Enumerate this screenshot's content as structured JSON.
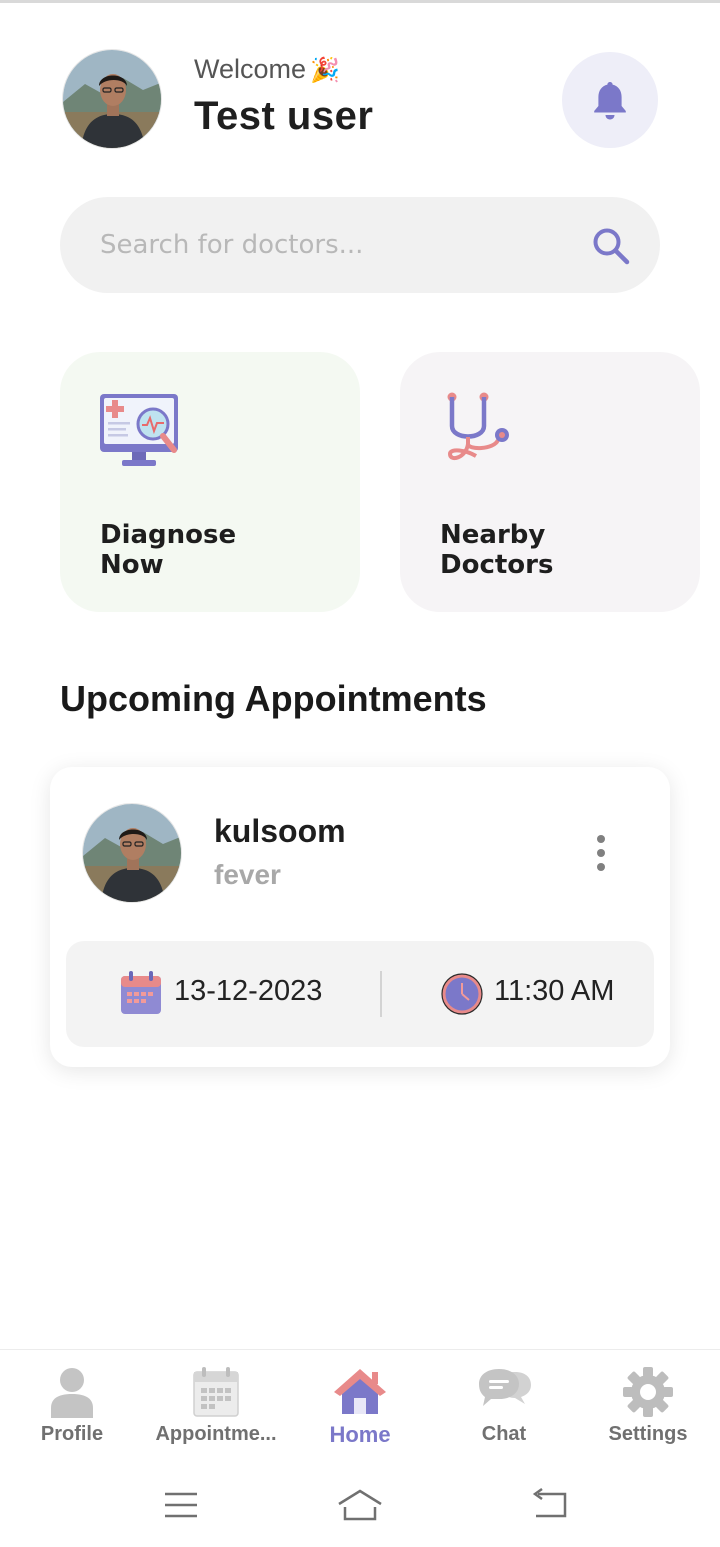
{
  "header": {
    "welcome": "Welcome",
    "welcome_emoji": "🎉",
    "username": "Test user",
    "avatar_icon": "user-avatar",
    "notification_icon": "bell-icon"
  },
  "search": {
    "placeholder": "Search for doctors...",
    "value": "",
    "icon": "search-icon"
  },
  "quick_actions": [
    {
      "label": "Diagnose Now",
      "icon": "monitor-diagnosis-icon"
    },
    {
      "label": "Nearby Doctors",
      "icon": "stethoscope-icon"
    }
  ],
  "appointments": {
    "title": "Upcoming Appointments",
    "items": [
      {
        "name": "kulsoom",
        "reason": "fever",
        "date": "13-12-2023",
        "time": "11:30 AM"
      }
    ]
  },
  "bottom_nav": {
    "active": "Home",
    "items": [
      {
        "label": "Profile",
        "icon": "person-icon"
      },
      {
        "label": "Appointme...",
        "icon": "calendar-icon"
      },
      {
        "label": "Home",
        "icon": "house-icon"
      },
      {
        "label": "Chat",
        "icon": "chat-bubbles-icon"
      },
      {
        "label": "Settings",
        "icon": "gear-icon"
      }
    ]
  },
  "colors": {
    "accent": "#7b78c9",
    "accent_light": "#eeeef8",
    "diagnose_card_bg": "#f4f9f2",
    "nearby_card_bg": "#f6f4f6",
    "pink": "#e88a8a"
  }
}
